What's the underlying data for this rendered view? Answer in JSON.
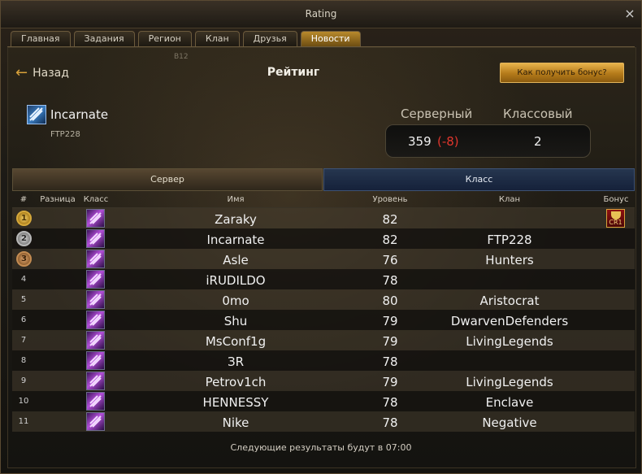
{
  "window": {
    "title": "Rating",
    "close_icon": "×"
  },
  "tabs": [
    {
      "label": "Главная",
      "active": false
    },
    {
      "label": "Задания",
      "active": false
    },
    {
      "label": "Регион",
      "active": false
    },
    {
      "label": "Клан",
      "active": false
    },
    {
      "label": "Друзья",
      "active": false
    },
    {
      "label": "Новости",
      "active": true
    }
  ],
  "header": {
    "back_label": "Назад",
    "title": "Рейтинг",
    "bonus_button": "Как получить бонус?",
    "tag": "B12"
  },
  "player": {
    "name": "Incarnate",
    "clan": "FTP228"
  },
  "ranks": {
    "server_label": "Серверный",
    "class_label": "Классовый",
    "server_value": "359",
    "server_diff": "(-8)",
    "class_value": "2"
  },
  "segments": {
    "left": "Сервер",
    "right": "Класс",
    "active": "right"
  },
  "columns": {
    "rank": "#",
    "diff": "Разница",
    "class": "Класс",
    "name": "Имя",
    "level": "Уровень",
    "clan": "Клан",
    "bonus": "Бонус"
  },
  "rows": [
    {
      "rank": "1",
      "medal": "gold",
      "name": "Zaraky",
      "level": "82",
      "clan": "",
      "bonus": "CR1"
    },
    {
      "rank": "2",
      "medal": "silver",
      "name": "Incarnate",
      "level": "82",
      "clan": "FTP228",
      "bonus": ""
    },
    {
      "rank": "3",
      "medal": "bronze",
      "name": "Asle",
      "level": "76",
      "clan": "Hunters",
      "bonus": ""
    },
    {
      "rank": "4",
      "medal": "",
      "name": "iRUDILDO",
      "level": "78",
      "clan": "",
      "bonus": ""
    },
    {
      "rank": "5",
      "medal": "",
      "name": "0mo",
      "level": "80",
      "clan": "Aristocrat",
      "bonus": ""
    },
    {
      "rank": "6",
      "medal": "",
      "name": "Shu",
      "level": "79",
      "clan": "DwarvenDefenders",
      "bonus": ""
    },
    {
      "rank": "7",
      "medal": "",
      "name": "MsConf1g",
      "level": "79",
      "clan": "LivingLegends",
      "bonus": ""
    },
    {
      "rank": "8",
      "medal": "",
      "name": "ЗR",
      "level": "78",
      "clan": "",
      "bonus": ""
    },
    {
      "rank": "9",
      "medal": "",
      "name": "Petrov1ch",
      "level": "79",
      "clan": "LivingLegends",
      "bonus": ""
    },
    {
      "rank": "10",
      "medal": "",
      "name": "HENNESSY",
      "level": "78",
      "clan": "Enclave",
      "bonus": ""
    },
    {
      "rank": "11",
      "medal": "",
      "name": "Nike",
      "level": "78",
      "clan": "Negative",
      "bonus": ""
    }
  ],
  "footer": "Следующие результаты будут в 07:00",
  "colors": {
    "accent": "#d9a23a",
    "negative": "#e0362d",
    "active_segment": "#1c2a44"
  }
}
